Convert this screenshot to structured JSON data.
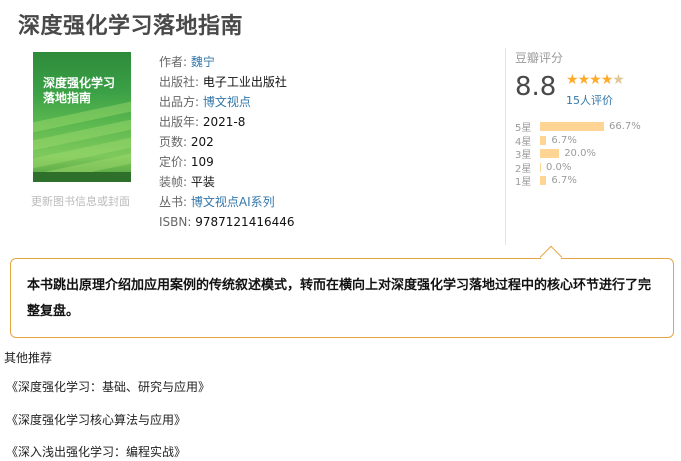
{
  "book": {
    "title": "深度强化学习落地指南",
    "cover": {
      "title_line1": "深度强化学习",
      "title_line2": "落地指南"
    },
    "update_link": "更新图书信息或封面",
    "info": [
      {
        "label": "作者:",
        "value": "魏宁",
        "link": true
      },
      {
        "label": "出版社:",
        "value": "电子工业出版社",
        "link": false
      },
      {
        "label": "出品方:",
        "value": "博文视点",
        "link": true
      },
      {
        "label": "出版年:",
        "value": "2021-8",
        "link": false
      },
      {
        "label": "页数:",
        "value": "202",
        "link": false
      },
      {
        "label": "定价:",
        "value": "109",
        "link": false
      },
      {
        "label": "装帧:",
        "value": "平装",
        "link": false
      },
      {
        "label": "丛书:",
        "value": "博文视点AI系列",
        "link": true
      },
      {
        "label": "ISBN:",
        "value": "9787121416446",
        "link": false
      }
    ]
  },
  "rating": {
    "label": "豆瓣评分",
    "score": "8.8",
    "stars_value": 4.5,
    "count_text": "15人评价",
    "distribution": [
      {
        "star": "5星",
        "pct": "66.7%",
        "value": 66.7
      },
      {
        "star": "4星",
        "pct": "6.7%",
        "value": 6.7
      },
      {
        "star": "3星",
        "pct": "20.0%",
        "value": 20.0
      },
      {
        "star": "2星",
        "pct": "0.0%",
        "value": 0.0
      },
      {
        "star": "1星",
        "pct": "6.7%",
        "value": 6.7
      }
    ]
  },
  "intro": {
    "text": "本书跳出原理介绍加应用案例的传统叙述模式，转而在横向上对深度强化学习落地过程中的核心环节进行了完整复盘。"
  },
  "other": {
    "heading": "其他推荐",
    "items": [
      "《深度强化学习：基础、研究与应用》",
      "《深度强化学习核心算法与应用》",
      "《深入浅出强化学习：编程实战》"
    ]
  },
  "colors": {
    "link": "#3377aa",
    "star": "#ffac2d",
    "bar": "#ffd596",
    "intro_border": "#e6a545"
  }
}
